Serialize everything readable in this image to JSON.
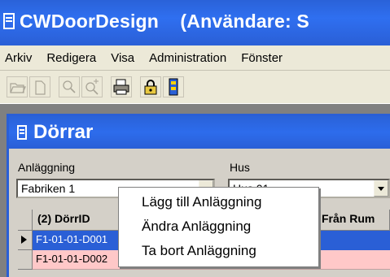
{
  "window": {
    "title": "CWDoorDesign    (Användare: S",
    "icon": "door-icon"
  },
  "menu": [
    "Arkiv",
    "Redigera",
    "Visa",
    "Administration",
    "Fönster"
  ],
  "toolbar": {
    "buttons": [
      "open-folder-icon",
      "new-document-icon",
      "zoom-icon",
      "zoom-in-icon",
      "print-icon",
      "lock-icon",
      "door-icon"
    ]
  },
  "child_window": {
    "title": "Dörrar",
    "fields": {
      "anlaggning_label": "Anläggning",
      "anlaggning_value": "Fabriken 1",
      "hus_label": "Hus",
      "hus_value": "Hus 01"
    },
    "grid": {
      "columns": [
        "(2) DörrID",
        "Från Rum"
      ],
      "rows": [
        {
          "doorid": "F1-01-01-D001",
          "selected": true
        },
        {
          "doorid": "F1-01-01-D002",
          "selected": false
        }
      ],
      "colors": {
        "selected": "#2a5fd6",
        "row": "#ffc8c8"
      }
    }
  },
  "context_menu": {
    "items": [
      "Lägg till Anläggning",
      "Ändra Anläggning",
      "Ta bort Anläggning"
    ]
  }
}
